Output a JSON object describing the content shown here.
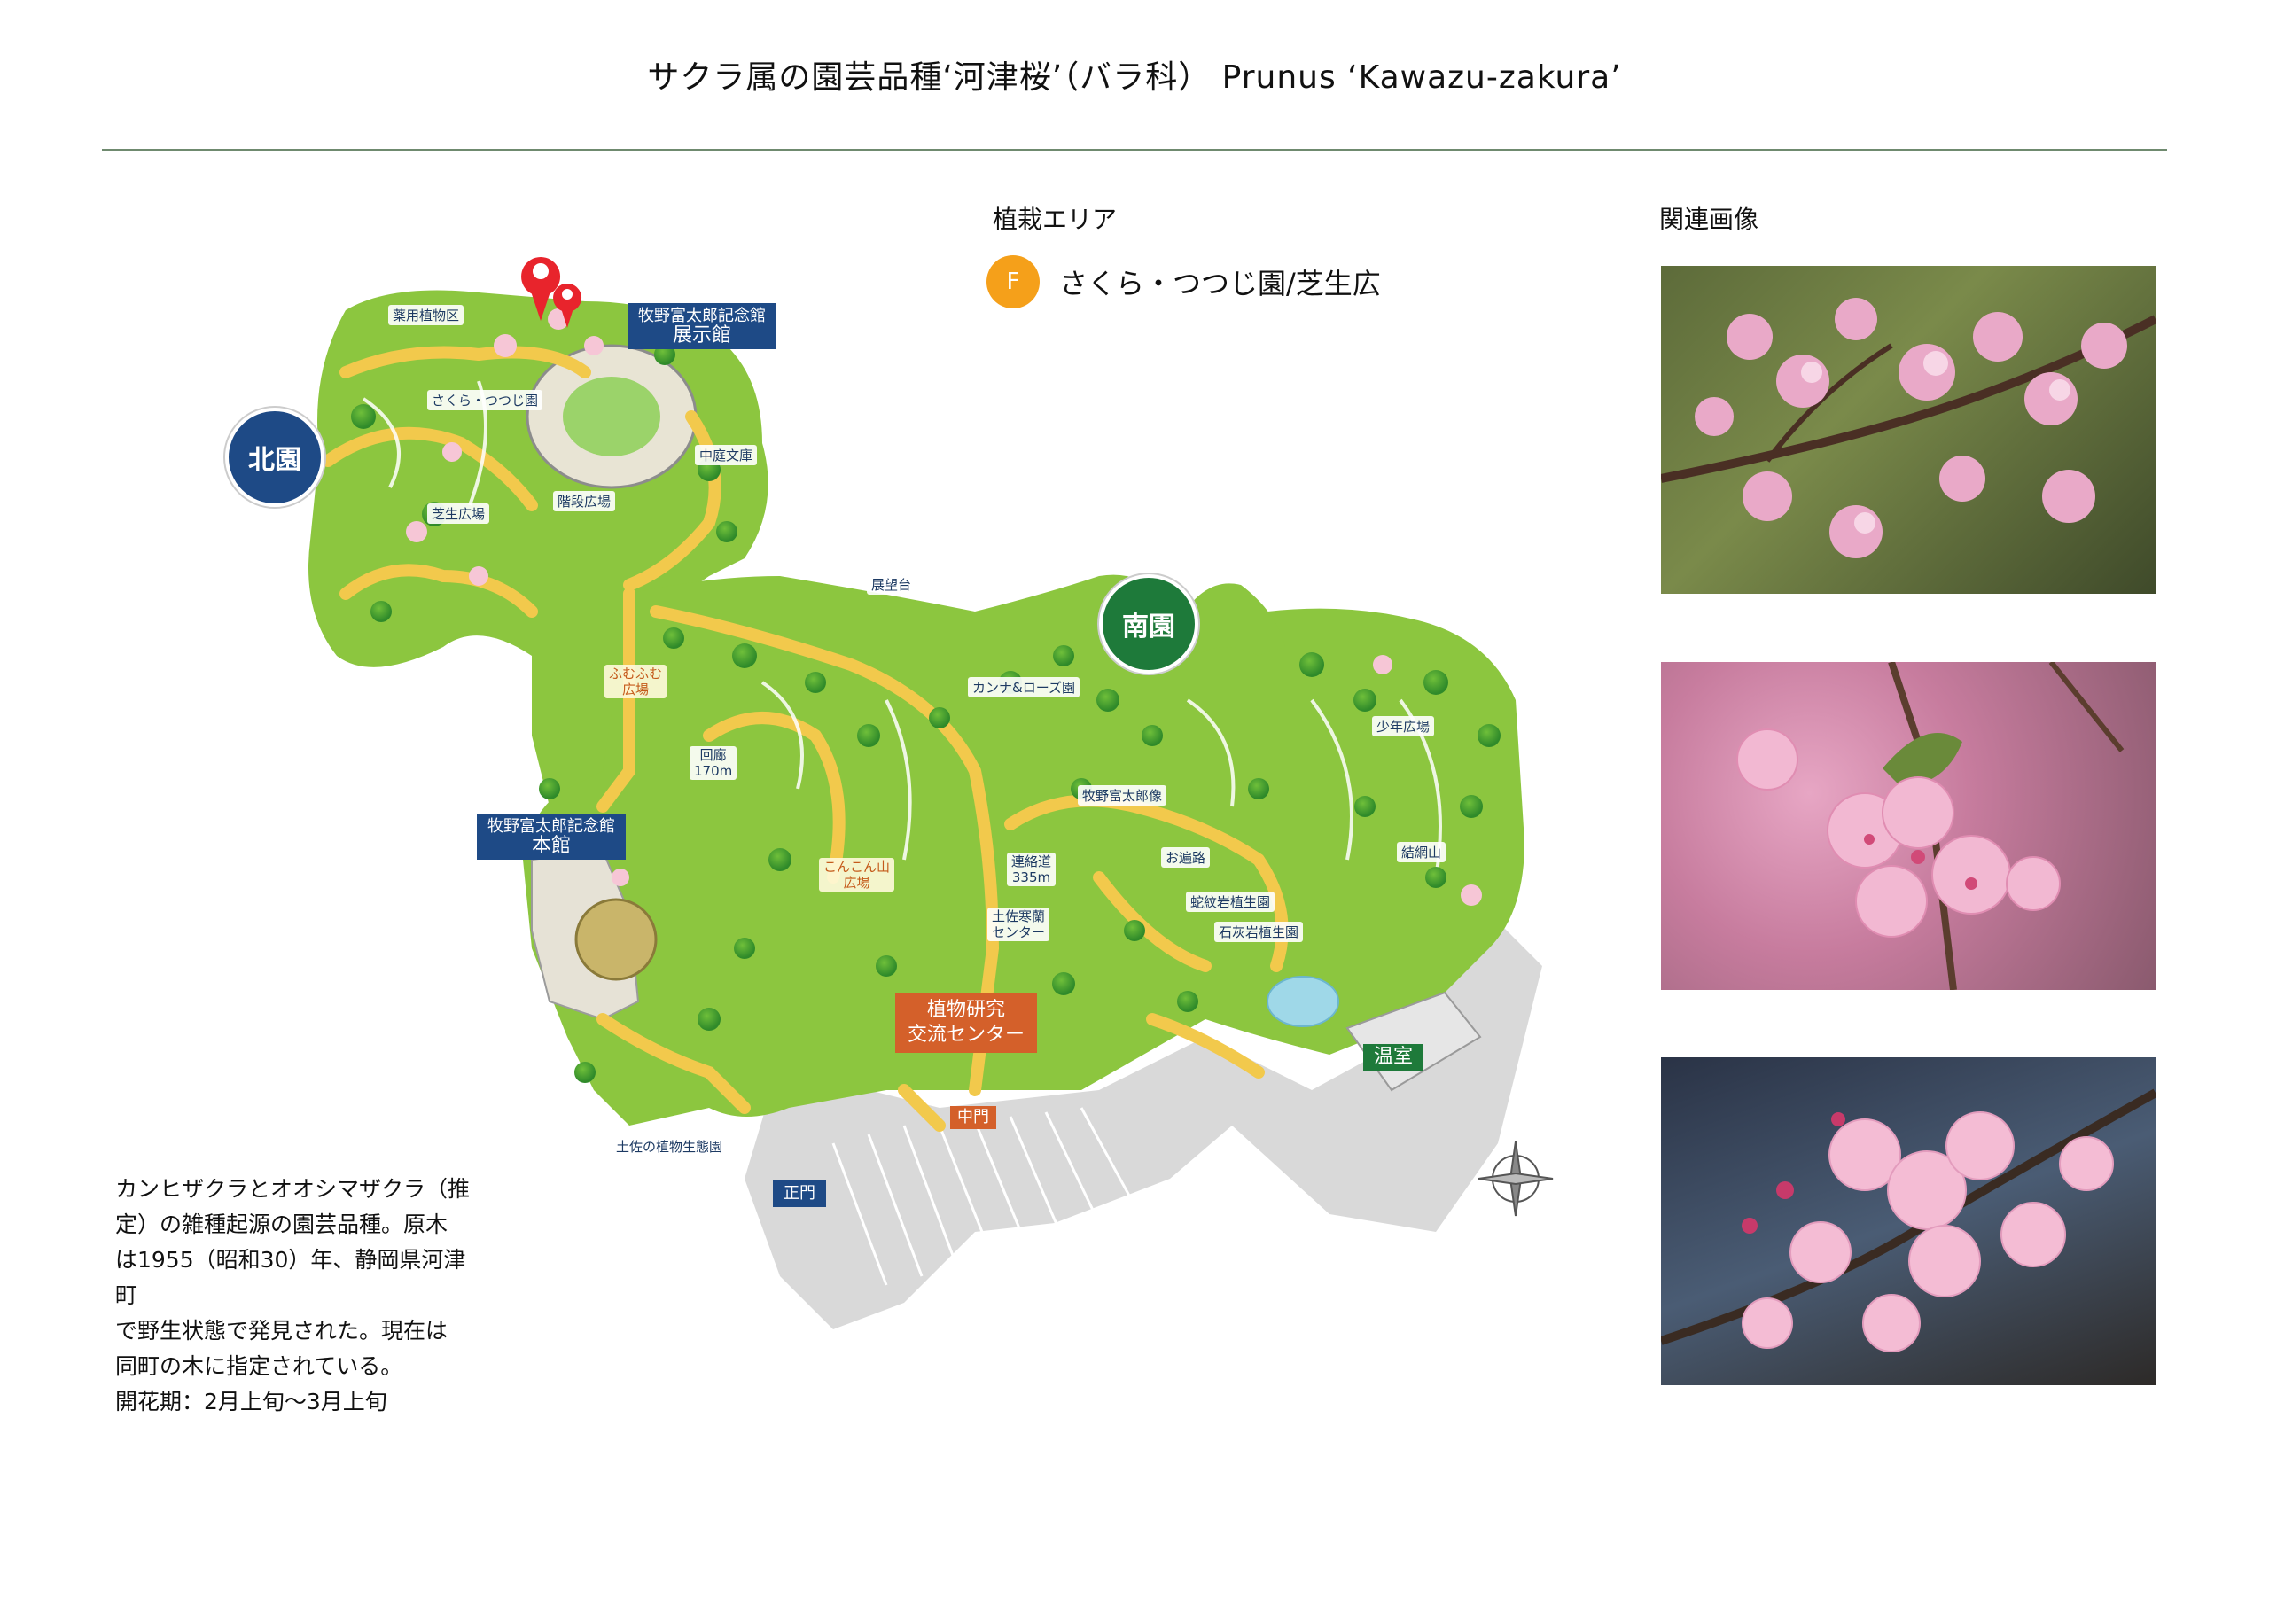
{
  "header": {
    "title": "サクラ属の園芸品種‘河津桜’（バラ科） Prunus ‘Kawazu-zakura’"
  },
  "planting": {
    "label": "植栽エリア",
    "badge": "F",
    "area_name": "さくら・つつじ園/芝生広"
  },
  "related": {
    "label": "関連画像"
  },
  "description": {
    "lines": [
      "カンヒザクラとオオシマザクラ（推",
      "定）の雑種起源の園芸品種。原木",
      "は1955（昭和30）年、静岡県河津町",
      "で野生状態で発見された。現在は",
      "同町の木に指定されている。",
      "開花期：2月上旬～3月上旬"
    ]
  },
  "map": {
    "zones": {
      "north": "北園",
      "south": "南園"
    },
    "signs": {
      "exhibit_1": "牧野富太郎記念館",
      "exhibit_2": "展示館",
      "main_1": "牧野富太郎記念館",
      "main_2": "本館",
      "center_1": "植物研究",
      "center_2": "交流センター",
      "greenhouse": "温室",
      "middle_gate": "中門",
      "main_gate": "正門"
    },
    "labels": {
      "yakuyo": "薬用植物区",
      "sakura": "さくら・つつじ園",
      "chutei": "中庭文庫",
      "kaidan": "階段広場",
      "shibafu": "芝生広場",
      "tenbodai": "展望台",
      "fumufumu_1": "ふむふむ",
      "fumufumu_2": "広場",
      "kairo_1": "回廊",
      "kairo_2": "170m",
      "canna": "カンナ&ローズ園",
      "makino_statue": "牧野富太郎像",
      "konkon_1": "こんこん山",
      "konkon_2": "広場",
      "renrakudo_1": "連絡道",
      "renrakudo_2": "335m",
      "tosa_kanran_1": "土佐寒蘭",
      "tosa_kanran_2": "センター",
      "ohenro": "お遍路",
      "jamongan": "蛇紋岩植生園",
      "sekkaigan": "石灰岩植生園",
      "shonen": "少年広場",
      "kekkoyama": "結網山",
      "tosa_seitai": "土佐の植物生態園"
    },
    "colors": {
      "grass": "#8cc63f",
      "path": "#f2c94c",
      "pin": "#e8242c",
      "navy": "#1e4a86"
    }
  },
  "photos": [
    {
      "name": "photo-1"
    },
    {
      "name": "photo-2"
    },
    {
      "name": "photo-3"
    }
  ]
}
